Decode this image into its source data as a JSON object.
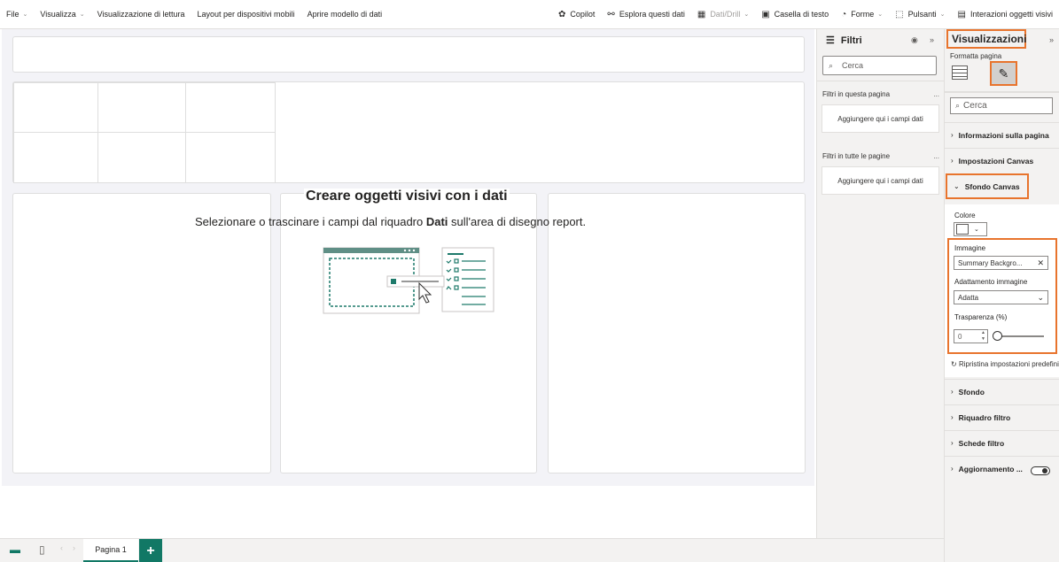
{
  "ribbon": {
    "left_items": [
      {
        "label": "File",
        "chevron": true
      },
      {
        "label": "Visualizza",
        "chevron": true
      },
      {
        "label": "Visualizzazione di lettura",
        "chevron": false
      },
      {
        "label": "Layout per dispositivi mobili",
        "chevron": false
      },
      {
        "label": "Aprire modello di dati",
        "chevron": false
      }
    ],
    "right_items": [
      {
        "label": "Copilot",
        "icon": "copilot-icon",
        "glyph": "✿",
        "chevron": false,
        "disabled": false
      },
      {
        "label": "Esplora questi dati",
        "icon": "binoculars-icon",
        "glyph": "⚯",
        "chevron": false,
        "disabled": false
      },
      {
        "label": "Dati/Drill",
        "icon": "data-drill-icon",
        "glyph": "▦",
        "chevron": true,
        "disabled": true
      },
      {
        "label": "Casella di testo",
        "icon": "textbox-icon",
        "glyph": "▣",
        "chevron": false,
        "disabled": false
      },
      {
        "label": "Forme",
        "icon": "shapes-icon",
        "glyph": "◔",
        "chevron": true,
        "disabled": false
      },
      {
        "label": "Pulsanti",
        "icon": "buttons-icon",
        "glyph": "⬚",
        "chevron": true,
        "disabled": false
      },
      {
        "label": "Interazioni oggetti visivi",
        "icon": "interactions-icon",
        "glyph": "▤",
        "chevron": false,
        "disabled": false
      }
    ]
  },
  "canvas": {
    "empty_title": "Creare oggetti visivi con i dati",
    "empty_sub_before": "Selezionare o trascinare i campi dal riquadro ",
    "empty_sub_bold": "Dati",
    "empty_sub_after": " sull'area di disegno report."
  },
  "bottom_bar": {
    "page_tab": "Pagina 1",
    "add_label": "+"
  },
  "filters": {
    "title": "Filtri",
    "search_placeholder": "Cerca",
    "section_page": "Filtri in questa pagina",
    "section_all": "Filtri in tutte le pagine",
    "drop_text": "Aggiungere qui i campi dati",
    "more": "..."
  },
  "visualizations": {
    "title": "Visualizzazioni",
    "subtitle": "Formatta pagina",
    "search_placeholder": "Cerca",
    "categories": {
      "page_info": "Informazioni sulla pagina",
      "canvas_settings": "Impostazioni Canvas",
      "canvas_background": "Sfondo Canvas",
      "background": "Sfondo",
      "filter_pane": "Riquadro filtro",
      "filter_cards": "Schede filtro",
      "refresh": "Aggiornamento ..."
    },
    "canvas_background": {
      "color_label": "Colore",
      "image_label": "Immagine",
      "image_value": "Summary Backgro...",
      "fit_label": "Adattamento immagine",
      "fit_value": "Adatta",
      "transparency_label": "Trasparenza (%)",
      "transparency_value": "0",
      "reset_label": "Ripristina impostazioni predefinite"
    }
  }
}
